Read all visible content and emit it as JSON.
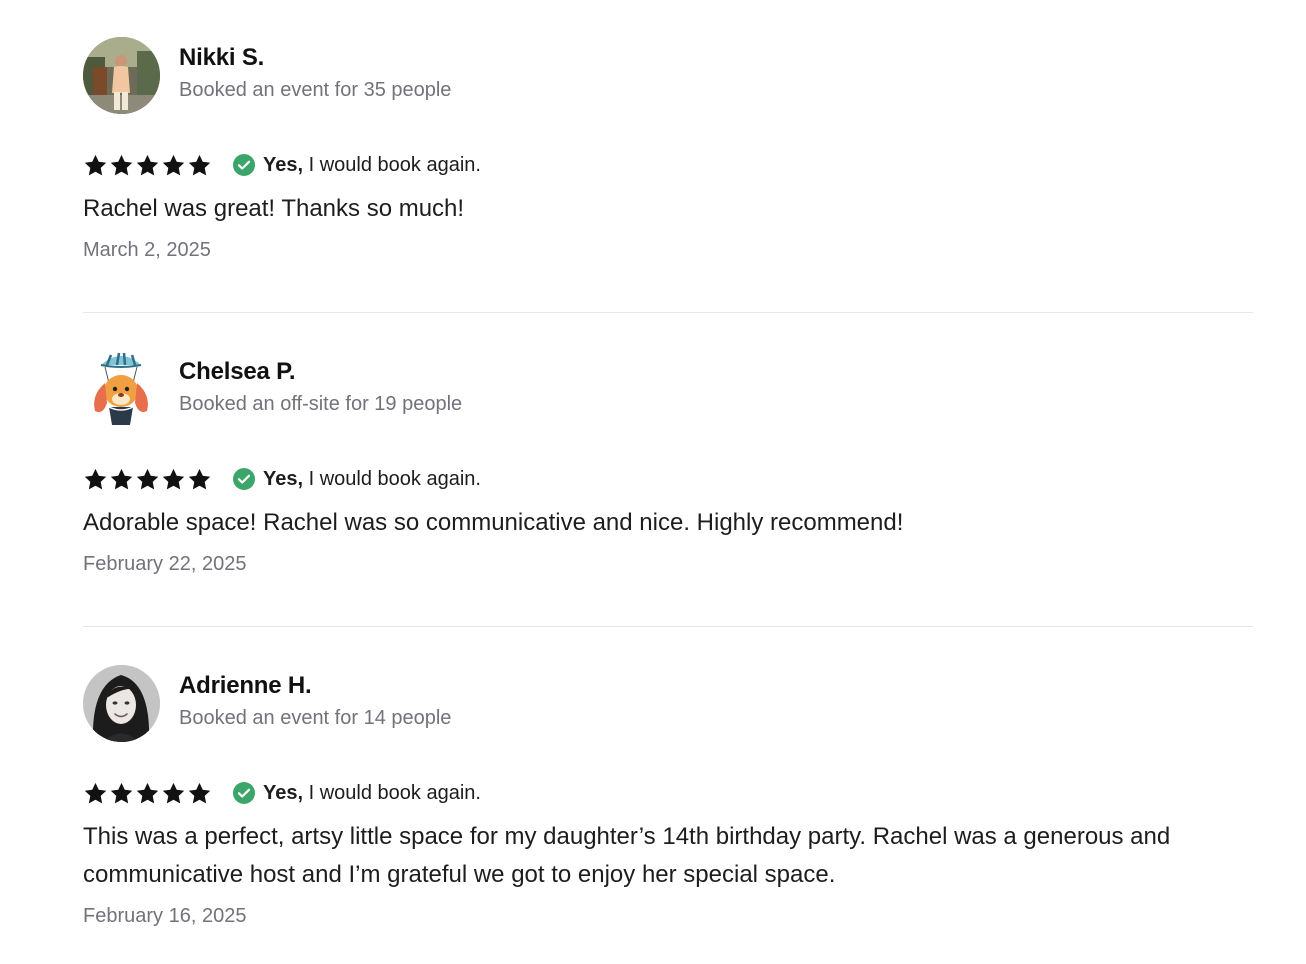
{
  "reviews": [
    {
      "name": "Nikki S.",
      "booked": "Booked an event for 35 people",
      "rating": 5,
      "would_book_bold": "Yes,",
      "would_book_rest": "I would book again.",
      "text": "Rachel was great! Thanks so much!",
      "date": "March 2, 2025",
      "avatar": "photo-avatar-outdoor"
    },
    {
      "name": "Chelsea P.",
      "booked": "Booked an off-site for 19 people",
      "rating": 5,
      "would_book_bold": "Yes,",
      "would_book_rest": "I would book again.",
      "text": "Adorable space! Rachel was so communicative and nice. Highly recommend!",
      "date": "February 22, 2025",
      "avatar": "bunny-balloon-avatar"
    },
    {
      "name": "Adrienne H.",
      "booked": "Booked an event for 14 people",
      "rating": 5,
      "would_book_bold": "Yes,",
      "would_book_rest": "I would book again.",
      "text": "This was a perfect, artsy little space for my daughter’s 14th birthday party. Rachel was a generous and communicative host and I’m grateful we got to enjoy her special space.",
      "date": "February 16, 2025",
      "avatar": "photo-avatar-portrait-bw"
    }
  ],
  "colors": {
    "star": "#111111",
    "check": "#3ba56a",
    "muted_text": "#72727c",
    "divider": "#e6e6ea"
  }
}
